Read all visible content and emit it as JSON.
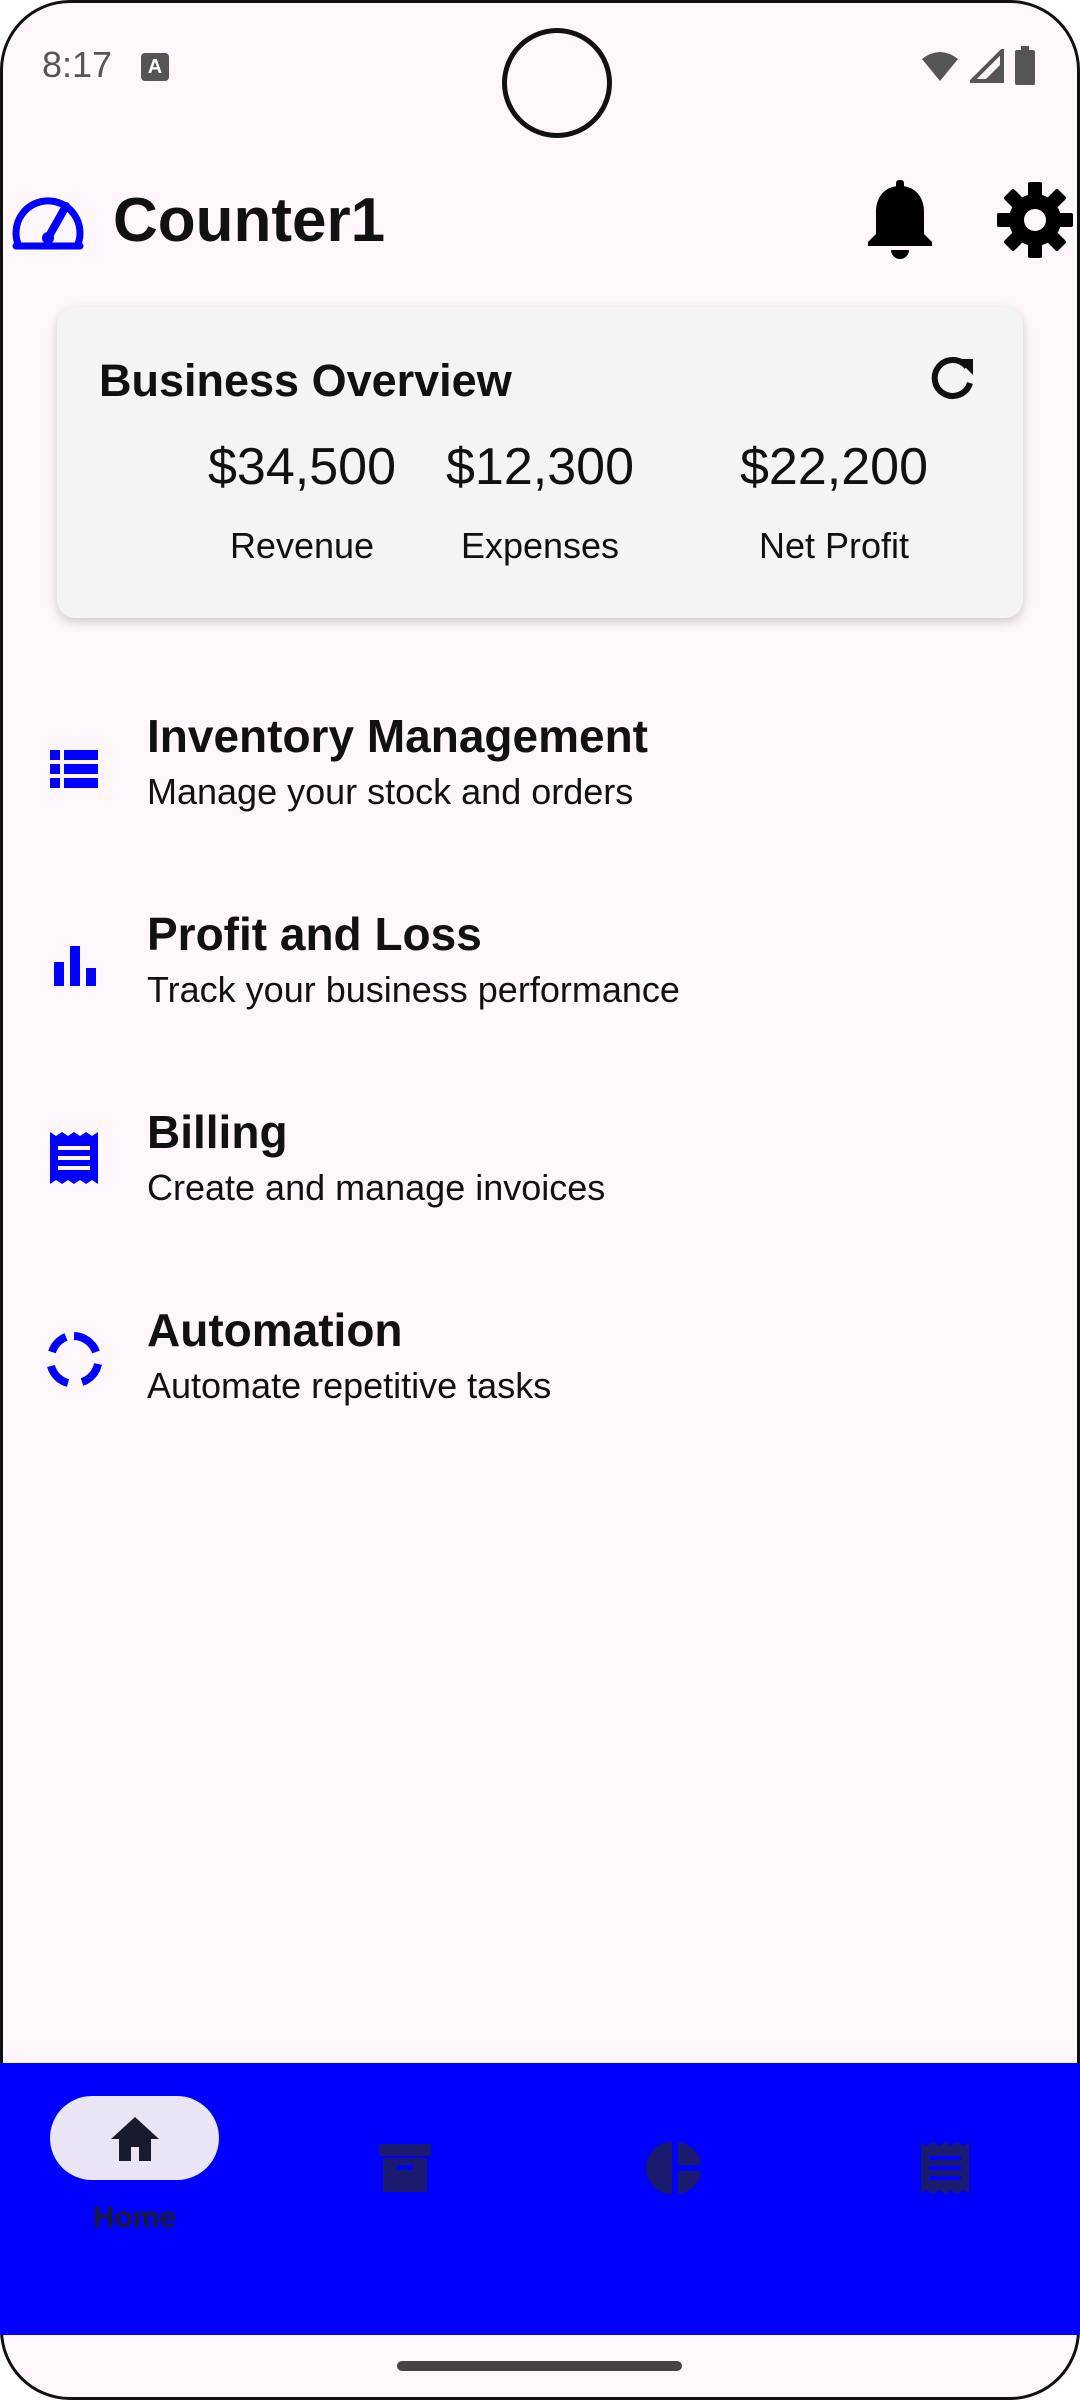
{
  "status": {
    "time": "8:17",
    "a_label": "A"
  },
  "app": {
    "title": "Counter1"
  },
  "overview": {
    "title": "Business Overview",
    "stats": [
      {
        "value": "$34,500",
        "label": "Revenue"
      },
      {
        "value": "$12,300",
        "label": "Expenses"
      },
      {
        "value": "$22,200",
        "label": "Net Profit"
      }
    ]
  },
  "menu": [
    {
      "title": "Inventory Management",
      "subtitle": "Manage your stock and orders",
      "icon": "list-icon"
    },
    {
      "title": "Profit and Loss",
      "subtitle": "Track your business performance",
      "icon": "bar-chart-icon"
    },
    {
      "title": "Billing",
      "subtitle": "Create and manage invoices",
      "icon": "receipt-icon"
    },
    {
      "title": "Automation",
      "subtitle": "Automate repetitive tasks",
      "icon": "loop-icon"
    }
  ],
  "bottom_nav": {
    "items": [
      {
        "label": "Home",
        "icon": "home-icon",
        "selected": true
      },
      {
        "label": "",
        "icon": "archive-icon",
        "selected": false
      },
      {
        "label": "",
        "icon": "pie-chart-icon",
        "selected": false
      },
      {
        "label": "",
        "icon": "receipt-icon",
        "selected": false
      }
    ]
  },
  "colors": {
    "accent": "#0000ff",
    "background": "#fdf6fb",
    "card": "#f4f4f4"
  }
}
